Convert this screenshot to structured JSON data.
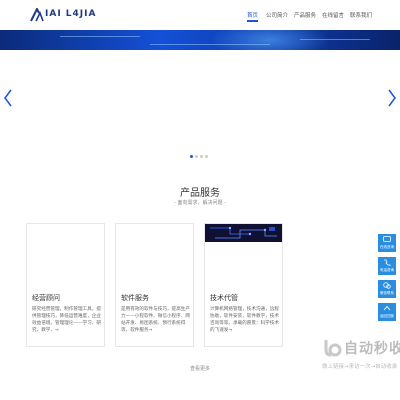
{
  "header": {
    "logo_text": "IAI L4JIA",
    "nav": [
      {
        "label": "首页",
        "active": true
      },
      {
        "label": "公司简介",
        "active": false
      },
      {
        "label": "产品服务",
        "active": false
      },
      {
        "label": "在线留言",
        "active": false
      },
      {
        "label": "联系我们",
        "active": false
      }
    ]
  },
  "carousel": {
    "slides": 4,
    "active_index": 0
  },
  "products": {
    "title": "产品服务",
    "subtitle": "- 面向需求，解决问题 -",
    "cards": [
      {
        "title": "经营顾问",
        "desc": "研究经营管理，制作管理工具，提供管理技巧，降低运营难度，企业效益倍增。管理理论——学习、研究、教学、→"
      },
      {
        "title": "软件服务",
        "desc": "是用有效的软件与技巧，提高生产力——小程软件、微信小程序、网站开发、易团系统、预行系统得等，软件服务→"
      },
      {
        "title": "技术代管",
        "desc": "计算机网络管理，技术沟通，远程协助，软件安装，软件教学，技术咨询等等。承载的愿景：科学技术的飞速发→"
      }
    ],
    "more_label": "查看更多"
  },
  "side_buttons": [
    "在线咨询",
    "电话咨询",
    "微信联系",
    "返回顶部"
  ],
  "watermark": {
    "title": "自动秒收录",
    "subtitle": "做上链接→来访一次→自动收录"
  }
}
